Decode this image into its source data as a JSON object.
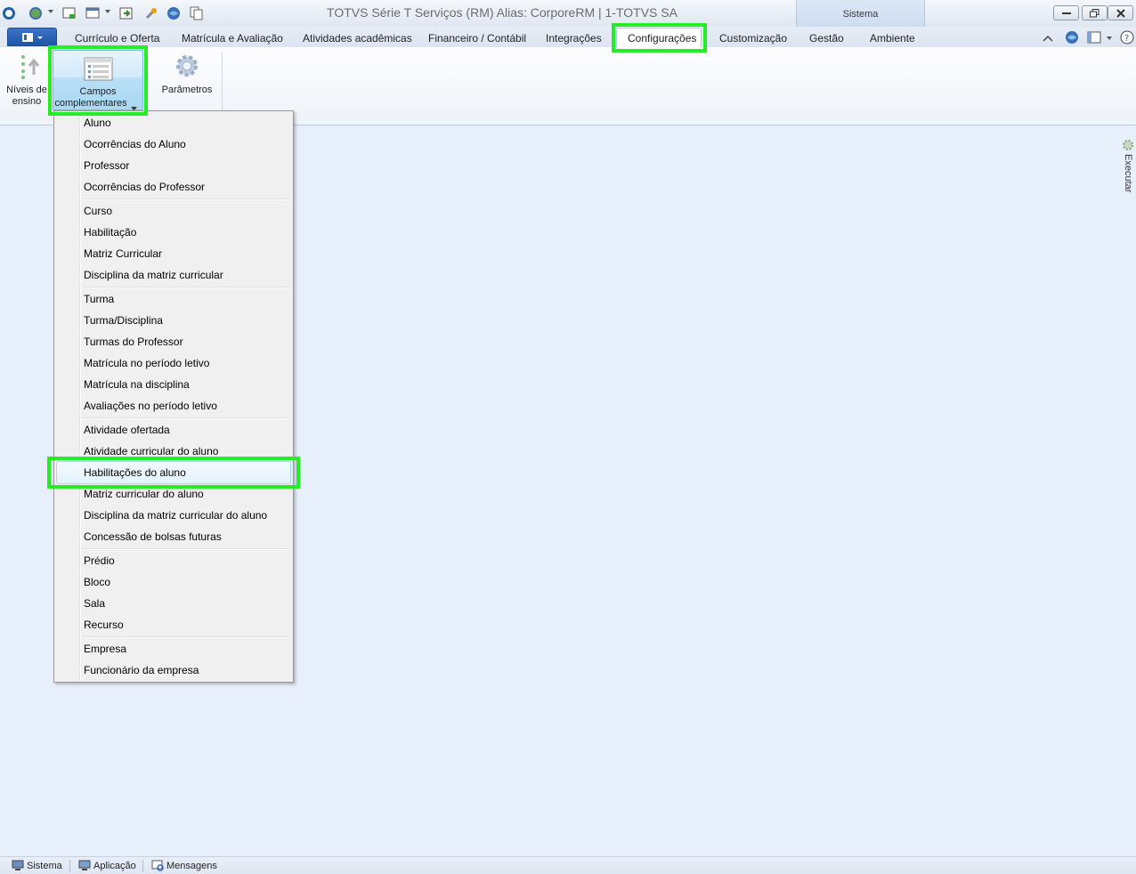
{
  "window": {
    "title": "TOTVS Série T Serviços (RM) Alias: CorporeRM | 1-TOTVS SA",
    "context_group": "Sistema"
  },
  "tabs": [
    {
      "label": "Currículo e Oferta"
    },
    {
      "label": "Matrícula e Avaliação"
    },
    {
      "label": "Atividades acadêmicas"
    },
    {
      "label": "Financeiro / Contábil"
    },
    {
      "label": "Integrações"
    },
    {
      "label": "Configurações",
      "active": true
    },
    {
      "label": "Customização"
    },
    {
      "label": "Gestão"
    },
    {
      "label": "Ambiente"
    }
  ],
  "ribbon": {
    "niveis": {
      "line1": "Níveis de",
      "line2": "ensino"
    },
    "campos": {
      "line1": "Campos",
      "line2": "complementares"
    },
    "parametros": {
      "label": "Parâmetros"
    }
  },
  "menu": {
    "items": [
      "Aluno",
      "Ocorrências do Aluno",
      "Professor",
      "Ocorrências do Professor",
      "Curso",
      "Habilitação",
      "Matriz Curricular",
      "Disciplina da matriz curricular",
      "Turma",
      "Turma/Disciplina",
      "Turmas do Professor",
      "Matrícula no período letivo",
      "Matrícula na disciplina",
      "Avaliações no período letivo",
      "Atividade ofertada",
      "Atividade curricular do aluno",
      "Habilitações do aluno",
      "Matriz curricular do aluno",
      "Disciplina da matriz curricular do aluno",
      "Concessão de bolsas futuras",
      "Prédio",
      "Bloco",
      "Sala",
      "Recurso",
      "Empresa",
      "Funcionário da empresa"
    ],
    "hovered": "Habilitações do aluno"
  },
  "side_panel": {
    "label": "Executar"
  },
  "statusbar": {
    "items": [
      "Sistema",
      "Aplicação",
      "Mensagens"
    ]
  },
  "colors": {
    "highlight": "#22ee22",
    "background": "#e7effa",
    "app_button": "#2a62b8"
  }
}
